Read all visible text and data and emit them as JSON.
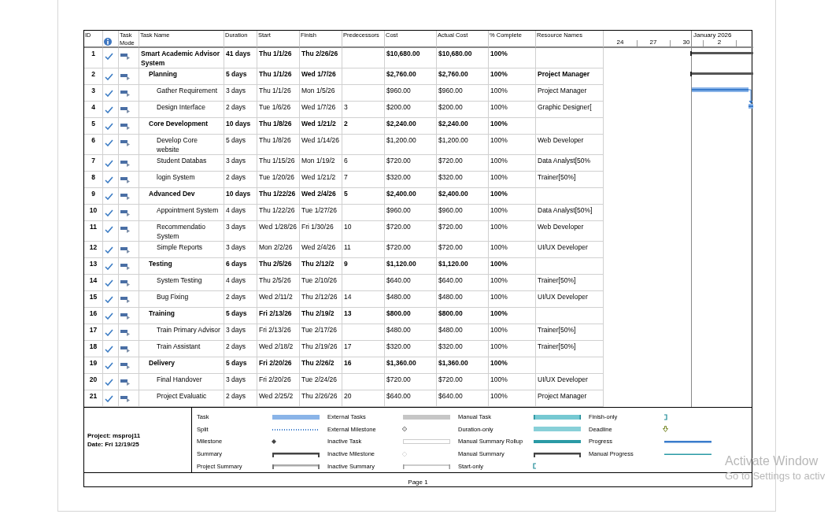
{
  "columns": [
    {
      "label": "ID"
    },
    {
      "kind": "info-icon"
    },
    {
      "label": "Task Mode"
    },
    {
      "label": "Task Name"
    },
    {
      "label": "Duration"
    },
    {
      "label": "Start"
    },
    {
      "label": "Finish"
    },
    {
      "label": "Predecessors"
    },
    {
      "label": "Cost"
    },
    {
      "label": "Actual Cost"
    },
    {
      "label": "% Complete"
    },
    {
      "label": "Resource Names"
    }
  ],
  "timeline": {
    "month": "January 2026",
    "days": [
      "24",
      "27",
      "30",
      "2"
    ]
  },
  "tasks": [
    {
      "id": "1",
      "name": "Smart Academic Advisor System",
      "done": true,
      "duration": "41 days",
      "start": "Thu 1/1/26",
      "finish": "Thu 2/26/26",
      "cost": "$10,680.00",
      "actual_cost": "$10,680.00",
      "complete": "100%",
      "children": [
        {
          "id": "2",
          "name": "Planning",
          "done": true,
          "duration": "5 days",
          "start": "Thu 1/1/26",
          "finish": "Wed 1/7/26",
          "cost": "$2,760.00",
          "actual_cost": "$2,760.00",
          "complete": "100%",
          "resources": "Project Manager",
          "children": [
            {
              "id": "3",
              "name": "Gather Requirement",
              "done": true,
              "duration": "3 days",
              "start": "Thu 1/1/26",
              "finish": "Mon 1/5/26",
              "cost": "$960.00",
              "actual_cost": "$960.00",
              "complete": "100%",
              "resources": "Project Manager"
            },
            {
              "id": "4",
              "name": "Design Interface",
              "done": true,
              "duration": "2 days",
              "start": "Tue 1/6/26",
              "finish": "Wed 1/7/26",
              "predecessors": "3",
              "cost": "$200.00",
              "actual_cost": "$200.00",
              "complete": "100%",
              "resources": "Graphic Designer["
            }
          ]
        },
        {
          "id": "5",
          "name": "Core Development",
          "done": true,
          "duration": "10 days",
          "start": "Thu 1/8/26",
          "finish": "Wed 1/21/2",
          "predecessors": "2",
          "cost": "$2,240.00",
          "actual_cost": "$2,240.00",
          "complete": "100%",
          "children": [
            {
              "id": "6",
              "name": "Develop Core website",
              "done": true,
              "duration": "5 days",
              "start": "Thu 1/8/26",
              "finish": "Wed 1/14/26",
              "cost": "$1,200.00",
              "actual_cost": "$1,200.00",
              "complete": "100%",
              "resources": "Web Developer"
            },
            {
              "id": "7",
              "name": "Student Databas",
              "done": true,
              "duration": "3 days",
              "start": "Thu 1/15/26",
              "finish": "Mon 1/19/2",
              "predecessors": "6",
              "cost": "$720.00",
              "actual_cost": "$720.00",
              "complete": "100%",
              "resources": "Data Analyst[50%"
            },
            {
              "id": "8",
              "name": "login System",
              "done": true,
              "duration": "2 days",
              "start": "Tue 1/20/26",
              "finish": "Wed 1/21/2",
              "predecessors": "7",
              "cost": "$320.00",
              "actual_cost": "$320.00",
              "complete": "100%",
              "resources": "Trainer[50%]"
            }
          ]
        },
        {
          "id": "9",
          "name": "Advanced Dev",
          "done": true,
          "duration": "10 days",
          "start": "Thu 1/22/26",
          "finish": "Wed 2/4/26",
          "predecessors": "5",
          "cost": "$2,400.00",
          "actual_cost": "$2,400.00",
          "complete": "100%",
          "children": [
            {
              "id": "10",
              "name": "Appointment System",
              "done": true,
              "duration": "4 days",
              "start": "Thu 1/22/26",
              "finish": "Tue 1/27/26",
              "cost": "$960.00",
              "actual_cost": "$960.00",
              "complete": "100%",
              "resources": "Data Analyst[50%]"
            },
            {
              "id": "11",
              "name": "Recommendatio System",
              "done": true,
              "duration": "3 days",
              "start": "Wed 1/28/26",
              "finish": "Fri 1/30/26",
              "predecessors": "10",
              "cost": "$720.00",
              "actual_cost": "$720.00",
              "complete": "100%",
              "resources": "Web Developer"
            },
            {
              "id": "12",
              "name": "Simple Reports",
              "done": true,
              "duration": "3 days",
              "start": "Mon 2/2/26",
              "finish": "Wed 2/4/26",
              "predecessors": "11",
              "cost": "$720.00",
              "actual_cost": "$720.00",
              "complete": "100%",
              "resources": "UI/UX Developer"
            }
          ]
        },
        {
          "id": "13",
          "name": "Testing",
          "done": true,
          "duration": "6 days",
          "start": "Thu 2/5/26",
          "finish": "Thu 2/12/2",
          "predecessors": "9",
          "cost": "$1,120.00",
          "actual_cost": "$1,120.00",
          "complete": "100%",
          "children": [
            {
              "id": "14",
              "name": "System Testing",
              "done": true,
              "duration": "4 days",
              "start": "Thu 2/5/26",
              "finish": "Tue 2/10/26",
              "cost": "$640.00",
              "actual_cost": "$640.00",
              "complete": "100%",
              "resources": "Trainer[50%]"
            },
            {
              "id": "15",
              "name": "Bug Fixing",
              "done": true,
              "duration": "2 days",
              "start": "Wed 2/11/2",
              "finish": "Thu 2/12/26",
              "predecessors": "14",
              "cost": "$480.00",
              "actual_cost": "$480.00",
              "complete": "100%",
              "resources": "UI/UX Developer"
            }
          ]
        },
        {
          "id": "16",
          "name": "Training",
          "done": true,
          "duration": "5 days",
          "start": "Fri 2/13/26",
          "finish": "Thu 2/19/2",
          "predecessors": "13",
          "cost": "$800.00",
          "actual_cost": "$800.00",
          "complete": "100%",
          "children": [
            {
              "id": "17",
              "name": "Train Primary Advisor",
              "done": true,
              "duration": "3 days",
              "start": "Fri 2/13/26",
              "finish": "Tue 2/17/26",
              "cost": "$480.00",
              "actual_cost": "$480.00",
              "complete": "100%",
              "resources": "Trainer[50%]"
            },
            {
              "id": "18",
              "name": "Train Assistant",
              "done": true,
              "duration": "2 days",
              "start": "Wed 2/18/2",
              "finish": "Thu 2/19/26",
              "predecessors": "17",
              "cost": "$320.00",
              "actual_cost": "$320.00",
              "complete": "100%",
              "resources": "Trainer[50%]"
            }
          ]
        },
        {
          "id": "19",
          "name": "Delivery",
          "done": true,
          "duration": "5 days",
          "start": "Fri 2/20/26",
          "finish": "Thu 2/26/2",
          "predecessors": "16",
          "cost": "$1,360.00",
          "actual_cost": "$1,360.00",
          "complete": "100%",
          "children": [
            {
              "id": "20",
              "name": "Final Handover",
              "done": true,
              "duration": "3 days",
              "start": "Fri 2/20/26",
              "finish": "Tue 2/24/26",
              "cost": "$720.00",
              "actual_cost": "$720.00",
              "complete": "100%",
              "resources": "UI/UX Developer"
            },
            {
              "id": "21",
              "name": "Project Evaluatic",
              "done": true,
              "duration": "2 days",
              "start": "Wed 2/25/2",
              "finish": "Thu 2/26/26",
              "predecessors": "20",
              "cost": "$640.00",
              "actual_cost": "$640.00",
              "complete": "100%",
              "resources": "Project Manager"
            }
          ]
        }
      ]
    }
  ],
  "project_info": [
    "Project: msproj11",
    "Date: Fri 12/19/25"
  ],
  "legend": [
    {
      "label": "Task",
      "kind": "task"
    },
    {
      "label": "Split",
      "kind": "split"
    },
    {
      "label": "Milestone",
      "kind": "milestone"
    },
    {
      "label": "Summary",
      "kind": "summary"
    },
    {
      "label": "Project Summary",
      "kind": "project-summary"
    },
    {
      "label": "External Tasks",
      "kind": "external-task"
    },
    {
      "label": "External Milestone",
      "kind": "external-milestone"
    },
    {
      "label": "Inactive Task",
      "kind": "inactive-task"
    },
    {
      "label": "Inactive Milestone",
      "kind": "inactive-milestone"
    },
    {
      "label": "Inactive Summary",
      "kind": "inactive-summary"
    },
    {
      "label": "Manual Task",
      "kind": "manual-task"
    },
    {
      "label": "Duration-only",
      "kind": "duration-only"
    },
    {
      "label": "Manual Summary Rollup",
      "kind": "rollup"
    },
    {
      "label": "Manual Summary",
      "kind": "manual-summary"
    },
    {
      "label": "Start-only",
      "kind": "start-only"
    },
    {
      "label": "Finish-only",
      "kind": "finish-only"
    },
    {
      "label": "Deadline",
      "kind": "deadline"
    },
    {
      "label": "Progress",
      "kind": "progress"
    },
    {
      "label": "Manual Progress",
      "kind": "manual-progress"
    }
  ],
  "footer": {
    "page": "Page 1"
  },
  "activation": {
    "title": "Activate Window",
    "subtitle": "Go to Settings to activ"
  }
}
